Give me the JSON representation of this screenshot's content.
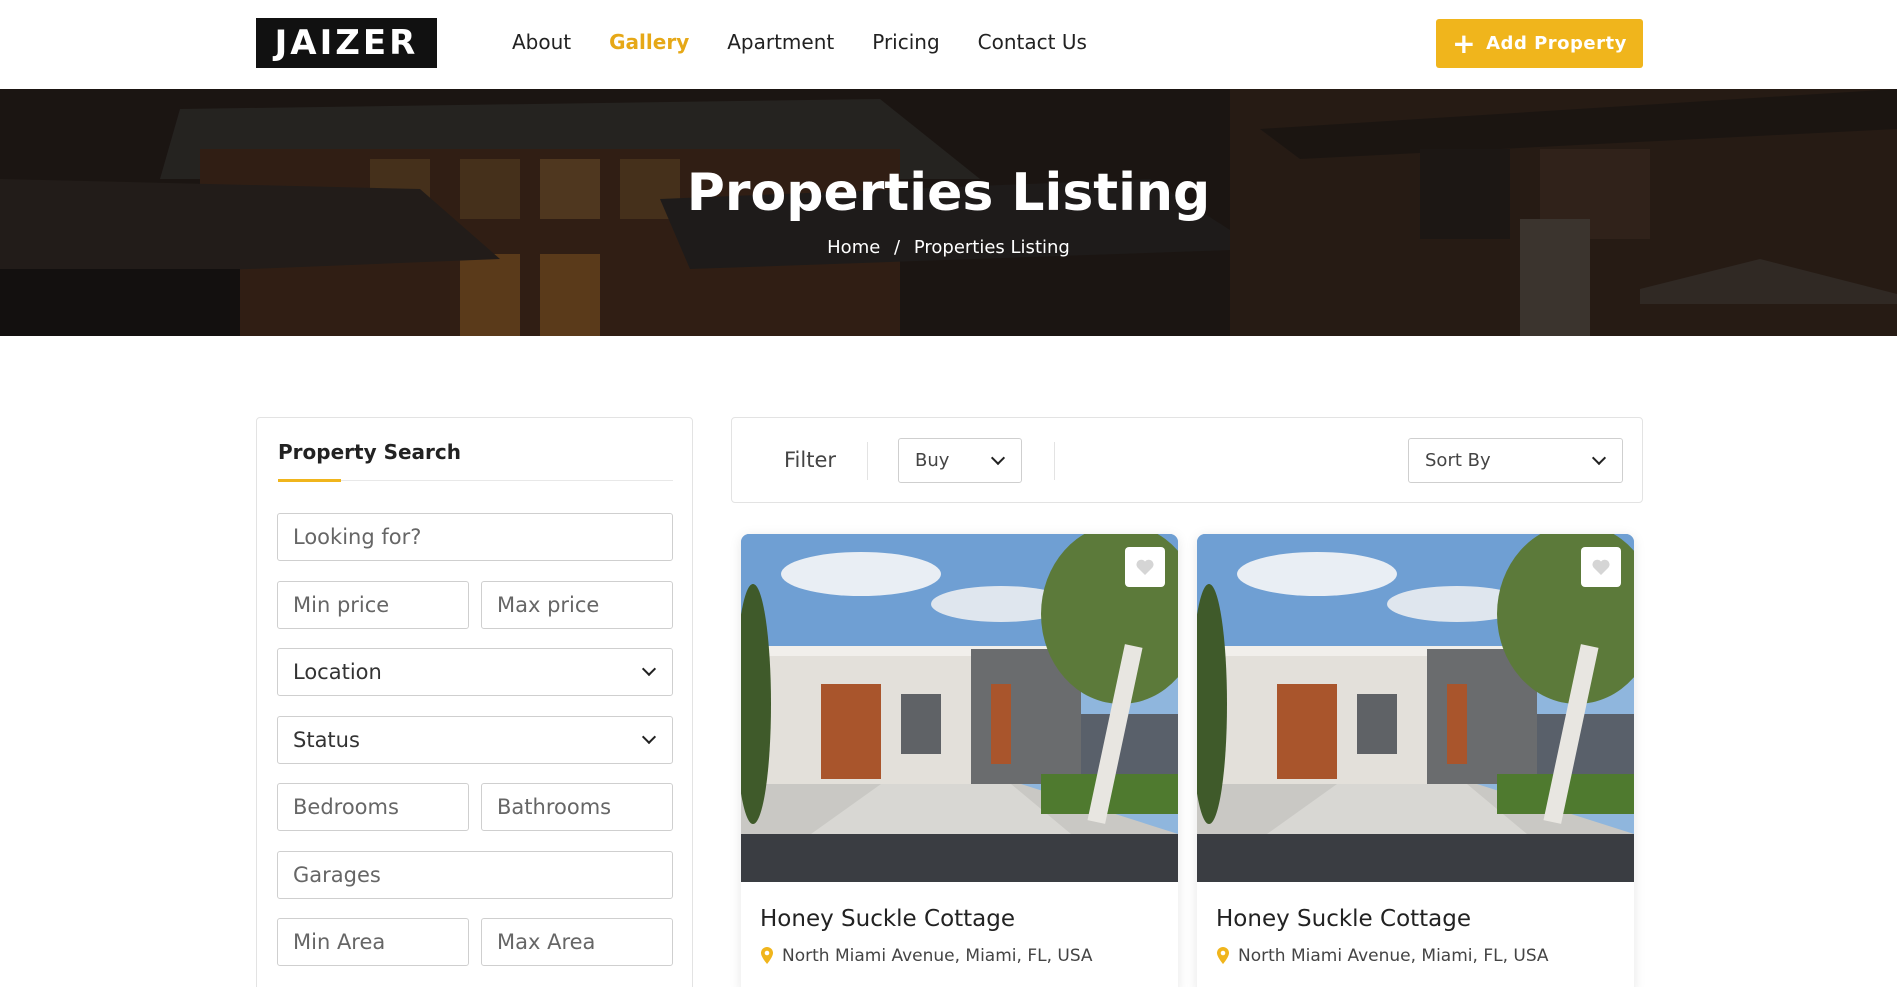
{
  "brand": {
    "logo_text": "JAIZER",
    "accent_color": "#f0b51c"
  },
  "nav": {
    "links": [
      {
        "label": "About"
      },
      {
        "label": "Gallery",
        "active": true
      },
      {
        "label": "Apartment"
      },
      {
        "label": "Pricing"
      },
      {
        "label": "Contact Us"
      }
    ],
    "add_property": {
      "label": "Add Property",
      "icon": "plus-icon"
    }
  },
  "hero": {
    "title": "Properties Listing",
    "breadcrumb": {
      "home": "Home",
      "separator": "/",
      "current": "Properties Listing"
    }
  },
  "sidebar": {
    "title": "Property Search",
    "fields": {
      "looking_for": "Looking for?",
      "min_price": "Min price",
      "max_price": "Max price",
      "location": "Location",
      "status": "Status",
      "bedrooms": "Bedrooms",
      "bathrooms": "Bathrooms",
      "garages": "Garages",
      "min_area": "Min Area",
      "max_area": "Max Area"
    }
  },
  "filter": {
    "label": "Filter",
    "type_selected": "Buy",
    "sort_selected": "Sort By"
  },
  "listings": [
    {
      "title": "Honey Suckle Cottage",
      "address": "North Miami Avenue, Miami, FL, USA",
      "icon": "heart-icon"
    },
    {
      "title": "Honey Suckle Cottage",
      "address": "North Miami Avenue, Miami, FL, USA",
      "icon": "heart-icon"
    }
  ]
}
